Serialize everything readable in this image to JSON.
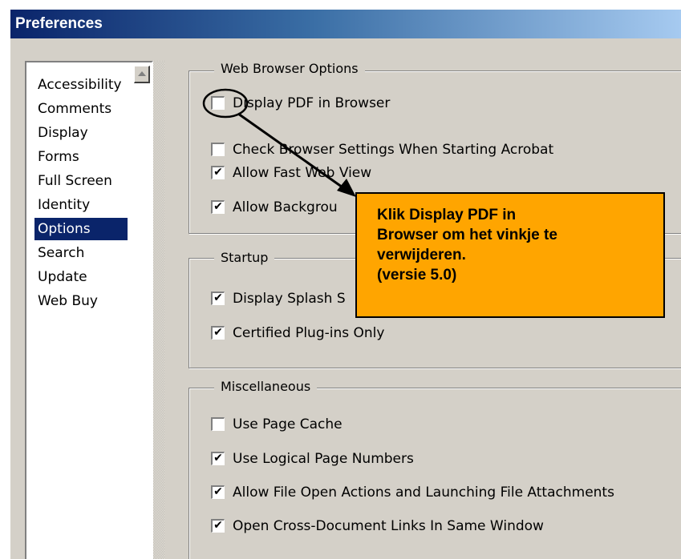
{
  "window": {
    "title": "Preferences"
  },
  "sidebar": {
    "items": [
      {
        "label": "Accessibility"
      },
      {
        "label": "Comments"
      },
      {
        "label": "Display"
      },
      {
        "label": "Forms"
      },
      {
        "label": "Full Screen"
      },
      {
        "label": "Identity"
      },
      {
        "label": "Options",
        "selected": true
      },
      {
        "label": "Search"
      },
      {
        "label": "Update"
      },
      {
        "label": "Web Buy"
      }
    ]
  },
  "groups": {
    "web_browser": {
      "label": "Web Browser Options",
      "options": [
        {
          "label": "Display PDF in Browser",
          "checked": false
        },
        {
          "label": "Check Browser Settings When Starting Acrobat",
          "checked": false
        },
        {
          "label": "Allow Fast Web View",
          "checked": true
        },
        {
          "label": "Allow Background Download",
          "visible_text": "Allow Backgrou",
          "checked": true
        }
      ]
    },
    "startup": {
      "label": "Startup",
      "options": [
        {
          "label": "Display Splash Screen",
          "visible_text": "Display Splash S",
          "checked": true
        },
        {
          "label": "Certified Plug-ins Only",
          "checked": true
        }
      ]
    },
    "misc": {
      "label": "Miscellaneous",
      "options": [
        {
          "label": "Use Page Cache",
          "checked": false
        },
        {
          "label": "Use Logical Page Numbers",
          "checked": true
        },
        {
          "label": "Allow File Open Actions and Launching File Attachments",
          "checked": true
        },
        {
          "label": "Open Cross-Document Links In Same Window",
          "checked": true
        }
      ]
    }
  },
  "callout": {
    "text": "Klik Display PDF in\nBrowser om het vinkje te\nverwijderen.\n(versie 5.0)"
  },
  "check_glyph": "✔",
  "colors": {
    "title_start": "#0a246a",
    "title_end": "#a6caf0",
    "selection": "#0a246a",
    "callout_fill": "#ffa500",
    "dialog_face": "#d4d0c8"
  }
}
